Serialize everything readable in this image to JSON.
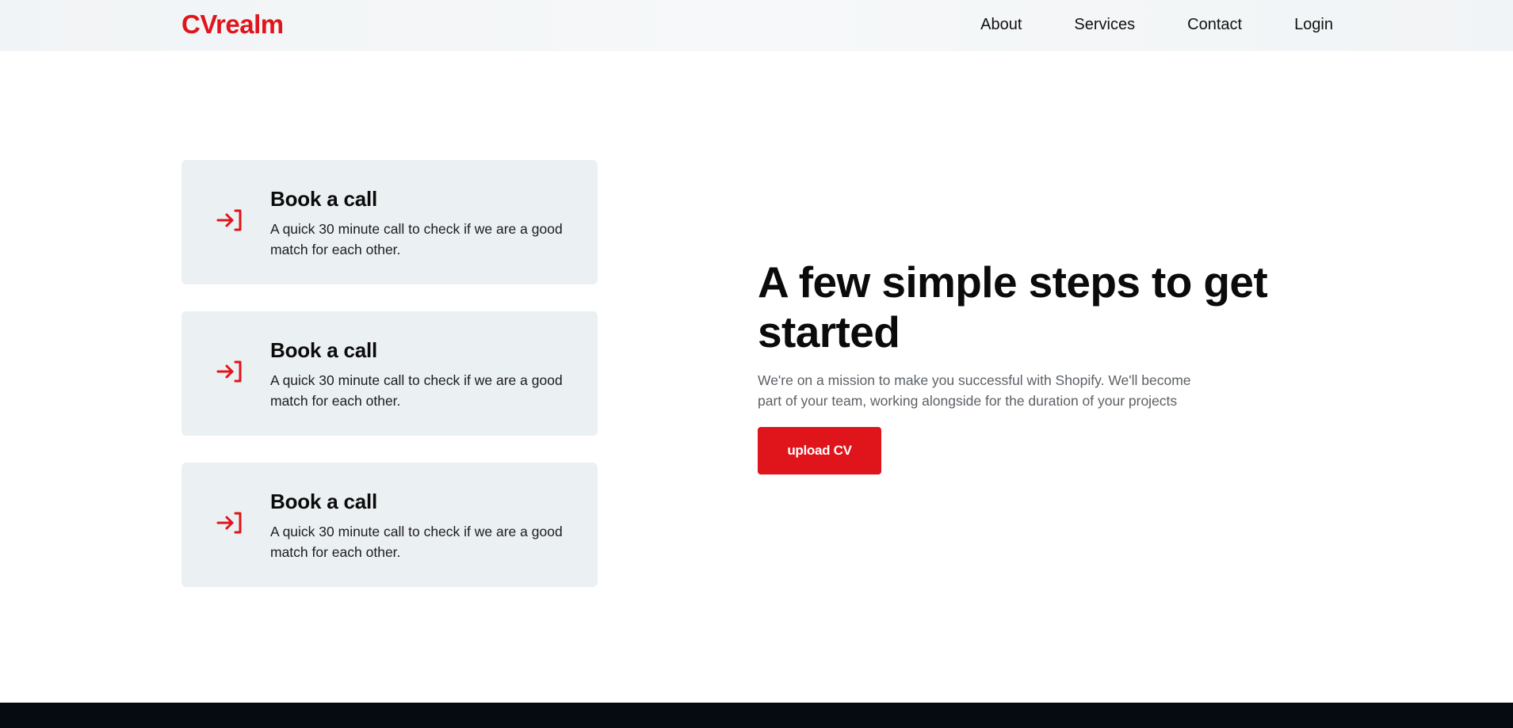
{
  "brand": {
    "name": "CVrealm",
    "accent": "#e0141b"
  },
  "nav": {
    "items": [
      "About",
      "Services",
      "Contact",
      "Login"
    ]
  },
  "steps": [
    {
      "icon": "login-arrow-icon",
      "title": "Book a call",
      "description": "A quick 30 minute call to check if we are a good match for each other."
    },
    {
      "icon": "login-arrow-icon",
      "title": "Book a call",
      "description": "A quick 30 minute call to check if we are a good match for each other."
    },
    {
      "icon": "login-arrow-icon",
      "title": "Book a call",
      "description": "A quick 30 minute call to check if we are a good match for each other."
    }
  ],
  "hero": {
    "title": "A few simple steps to get started",
    "text": "We're on a mission to make you successful with Shopify. We'll become part of your team, working alongside for the duration of your projects",
    "button_label": "upload CV"
  },
  "colors": {
    "card_background": "#ebf0f2",
    "footer_background": "#050b10",
    "muted_text": "#5c6166"
  }
}
